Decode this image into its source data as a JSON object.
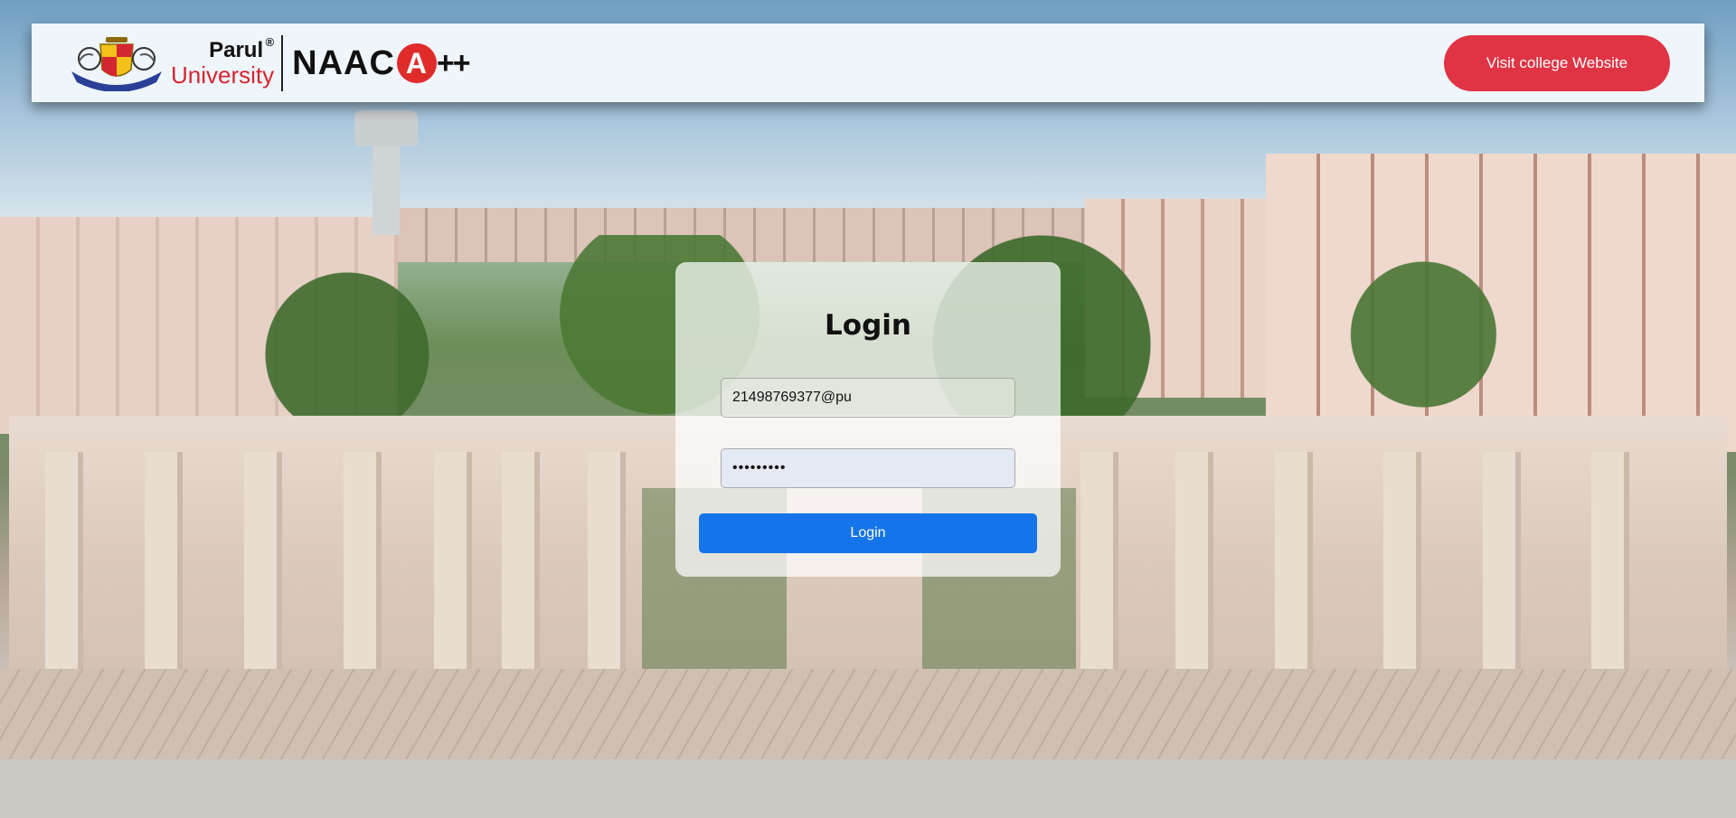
{
  "header": {
    "logo_wordmark_line1": "Parul",
    "logo_wordmark_reg": "®",
    "logo_wordmark_line2": "University",
    "accreditation_text": "NAAC",
    "accreditation_grade_letter": "A",
    "accreditation_grade_suffix": "++",
    "visit_button_label": "Visit college Website"
  },
  "login": {
    "title": "Login",
    "username_value": "21498769377@pu",
    "password_value": "•••••••••",
    "submit_label": "Login"
  },
  "colors": {
    "header_bg": "#eef5fb",
    "visit_button": "#e03444",
    "login_button": "#1574ea",
    "brand_red": "#d4262f"
  },
  "background": {
    "icon": "campus-photo"
  }
}
